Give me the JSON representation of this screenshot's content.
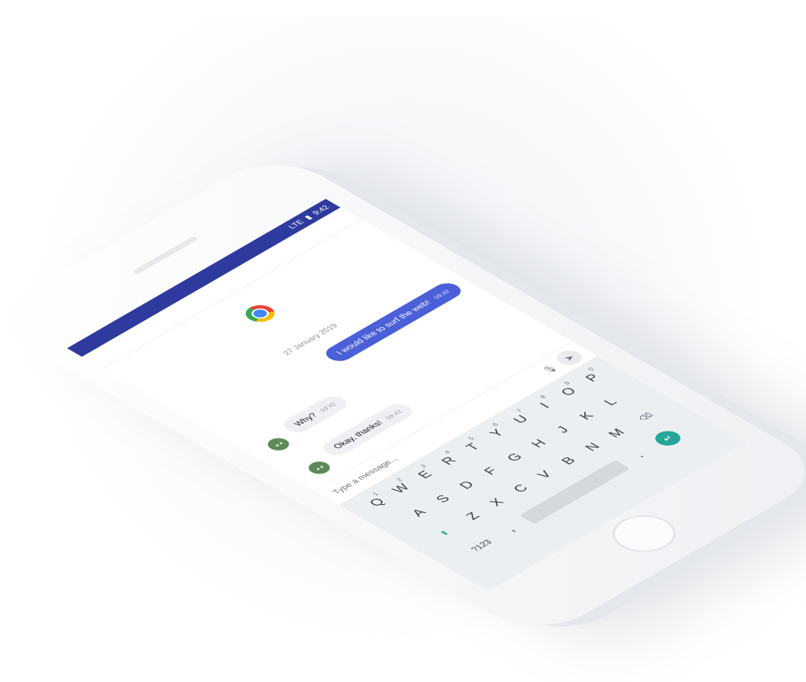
{
  "status": {
    "time": "9:42",
    "network": "LTE"
  },
  "chat": {
    "date": "27 January 2019",
    "messages": [
      {
        "text": "I would like to surf the web!",
        "time": "09:42",
        "direction": "out"
      },
      {
        "text": "Why?",
        "time": "09:42",
        "direction": "in"
      },
      {
        "text": "Okay, thanks!",
        "time": "09:42",
        "direction": "in"
      }
    ],
    "avatar_icon": "alien-icon",
    "browser_icon": "chrome-icon"
  },
  "composer": {
    "placeholder": "Type a message...",
    "send_icon": "send-icon",
    "mic_icon": "mic-icon"
  },
  "keyboard": {
    "row1": [
      {
        "k": "Q",
        "h": "1"
      },
      {
        "k": "W",
        "h": "2"
      },
      {
        "k": "E",
        "h": "3"
      },
      {
        "k": "R",
        "h": "4"
      },
      {
        "k": "T",
        "h": "5"
      },
      {
        "k": "Y",
        "h": "6"
      },
      {
        "k": "U",
        "h": "7"
      },
      {
        "k": "I",
        "h": "8"
      },
      {
        "k": "O",
        "h": "9"
      },
      {
        "k": "P",
        "h": "0"
      }
    ],
    "row2": [
      "A",
      "S",
      "D",
      "F",
      "G",
      "H",
      "J",
      "K",
      "L"
    ],
    "row3": [
      "Z",
      "X",
      "C",
      "V",
      "B",
      "N",
      "M"
    ],
    "symbols_label": "?123",
    "comma": ",",
    "period": ".",
    "colors": {
      "accent": "#26a69a",
      "status_bar": "#2f3a9e",
      "outgoing_bubble": "#4a5fd8"
    }
  }
}
